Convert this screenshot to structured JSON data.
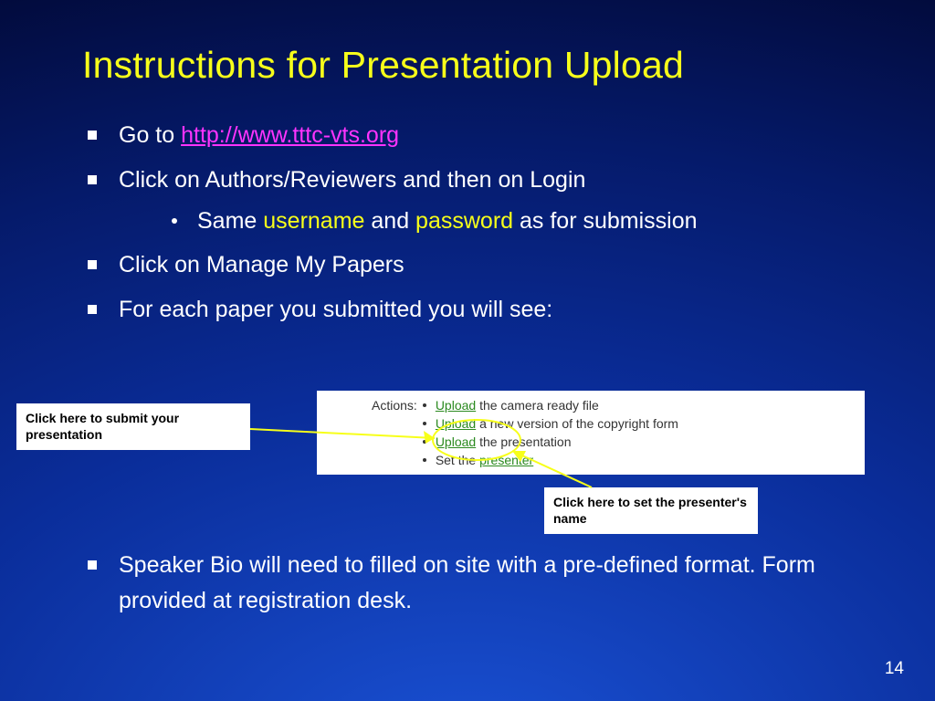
{
  "title": "Instructions for Presentation Upload",
  "bullets": {
    "b1_pre": "Go to ",
    "b1_link": "http://www.tttc-vts.org",
    "b2": "Click on Authors/Reviewers and then on Login",
    "b2_sub_pre": "Same ",
    "b2_sub_user": "username",
    "b2_sub_mid": " and ",
    "b2_sub_pass": "password",
    "b2_sub_post": " as for submission",
    "b3": "Click on Manage My Papers",
    "b4": "For each paper you submitted you will see:",
    "b5": "Speaker Bio will need to filled on site with a pre-defined format. Form provided at registration desk."
  },
  "actions": {
    "label": "Actions:",
    "items": [
      {
        "link": "Upload",
        "rest": " the camera ready file"
      },
      {
        "link": "Upload",
        "rest": " a new version of the copyright form"
      },
      {
        "link": "Upload",
        "rest": " the presentation"
      },
      {
        "pre": "Set the ",
        "link": "presenter",
        "rest": ""
      }
    ]
  },
  "callouts": {
    "left": "Click here to submit your presentation",
    "right": "Click here to set the presenter's name"
  },
  "page_number": "14",
  "colors": {
    "accent_yellow": "#f7ff1a",
    "link_magenta": "#ff33ff",
    "action_green": "#2b8a1f"
  }
}
